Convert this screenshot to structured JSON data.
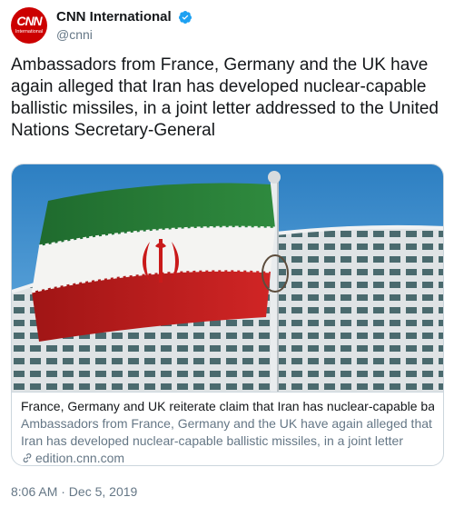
{
  "account": {
    "display_name": "CNN International",
    "handle": "@cnni",
    "avatar_text": "CNN",
    "avatar_subtext": "International",
    "verified": true
  },
  "tweet": {
    "text": "Ambassadors from France, Germany and the UK have again alleged that Iran has developed nuclear-capable ballistic missiles, in a joint letter addressed to the United Nations Secretary-General",
    "timestamp": "8:06 AM · Dec 5, 2019"
  },
  "card": {
    "title": "France, Germany and UK reiterate claim that Iran has nuclear-capable ballistic...",
    "description": "Ambassadors from France, Germany and the UK have again alleged that Iran has developed nuclear-capable ballistic missiles, in a joint letter addressed to ...",
    "domain": "edition.cnn.com",
    "image": "iranian-flag-photo"
  },
  "colors": {
    "brand_red": "#cc0000",
    "verified_blue": "#1da1f2",
    "secondary_text": "#657786",
    "border": "#ccd6dd"
  }
}
